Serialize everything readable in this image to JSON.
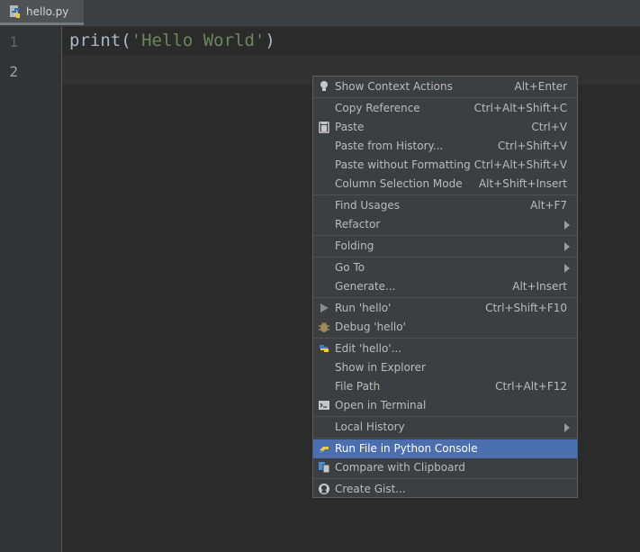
{
  "tab": {
    "label": "hello.py"
  },
  "gutter": {
    "line1": "1",
    "line2": "2"
  },
  "code": {
    "fn": "print(",
    "str": "'Hello World'",
    "close": ")"
  },
  "colors": {
    "selection": "#4b6eaf",
    "background": "#2b2b2b",
    "menu": "#3c3f41"
  },
  "menu": {
    "items": [
      {
        "label": "Show Context Actions",
        "shortcut": "Alt+Enter",
        "icon": "lightbulb-icon"
      },
      {
        "label": "Copy Reference",
        "shortcut": "Ctrl+Alt+Shift+C"
      },
      {
        "label": "Paste",
        "shortcut": "Ctrl+V",
        "icon": "clipboard-icon"
      },
      {
        "label": "Paste from History...",
        "shortcut": "Ctrl+Shift+V"
      },
      {
        "label": "Paste without Formatting",
        "shortcut": "Ctrl+Alt+Shift+V"
      },
      {
        "label": "Column Selection Mode",
        "shortcut": "Alt+Shift+Insert"
      },
      {
        "label": "Find Usages",
        "shortcut": "Alt+F7"
      },
      {
        "label": "Refactor",
        "shortcut": ""
      },
      {
        "label": "Folding",
        "shortcut": ""
      },
      {
        "label": "Go To",
        "shortcut": ""
      },
      {
        "label": "Generate...",
        "shortcut": "Alt+Insert"
      },
      {
        "label": "Run 'hello'",
        "shortcut": "Ctrl+Shift+F10",
        "icon": "run-icon"
      },
      {
        "label": "Debug 'hello'",
        "shortcut": "",
        "icon": "debug-icon"
      },
      {
        "label": "Edit 'hello'...",
        "shortcut": "",
        "icon": "python-icon"
      },
      {
        "label": "Show in Explorer",
        "shortcut": ""
      },
      {
        "label": "File Path",
        "shortcut": "Ctrl+Alt+F12"
      },
      {
        "label": "Open in Terminal",
        "shortcut": "",
        "icon": "terminal-icon"
      },
      {
        "label": "Local History",
        "shortcut": ""
      },
      {
        "label": "Run File in Python Console",
        "shortcut": "",
        "icon": "python-console-icon"
      },
      {
        "label": "Compare with Clipboard",
        "shortcut": "",
        "icon": "compare-icon"
      },
      {
        "label": "Create Gist...",
        "shortcut": "",
        "icon": "github-icon"
      }
    ]
  }
}
